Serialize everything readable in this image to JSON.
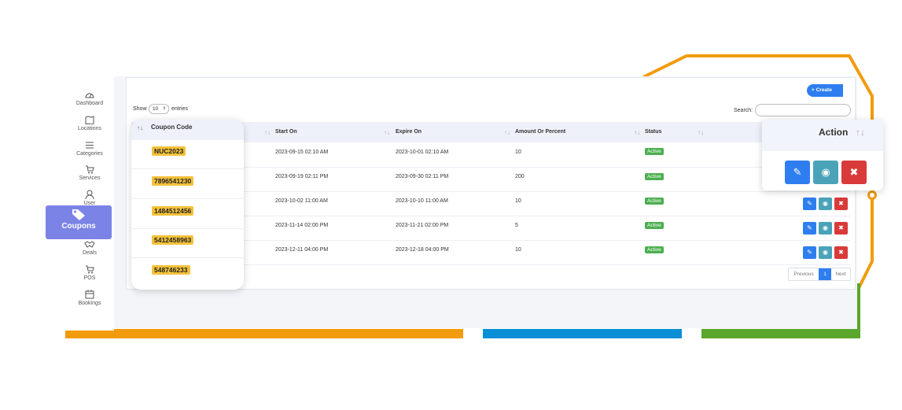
{
  "sidebar": {
    "items": [
      {
        "label": "Dashboard",
        "icon": "dashboard-icon"
      },
      {
        "label": "Locations",
        "icon": "location-icon"
      },
      {
        "label": "Categories",
        "icon": "list-icon"
      },
      {
        "label": "Services",
        "icon": "cart-icon"
      },
      {
        "label": "User",
        "icon": "user-icon"
      },
      {
        "label": "Deals",
        "icon": "handshake-icon"
      },
      {
        "label": "POS",
        "icon": "pos-cart-icon"
      },
      {
        "label": "Bookings",
        "icon": "calendar-icon"
      }
    ],
    "active": {
      "label": "Coupons",
      "icon": "tag-icon"
    }
  },
  "toolbar": {
    "create_label": "+ Create",
    "show_label": "Show",
    "entries_value": "10",
    "entries_label": "entries",
    "search_label": "Search:",
    "search_value": ""
  },
  "table": {
    "columns": [
      "Coupon Code",
      "Start On",
      "Expire On",
      "Amount Or Percent",
      "Status",
      "Action"
    ],
    "rows": [
      {
        "code": "NUC2023",
        "start": "2023-09-15 02:10 AM",
        "expire": "2023-10-01 02:10 AM",
        "amount": "10",
        "status": "Active"
      },
      {
        "code": "7896541230",
        "start": "2023-09-19 02:11 PM",
        "expire": "2023-09-30 02:11 PM",
        "amount": "200",
        "status": "Active"
      },
      {
        "code": "1484512456",
        "start": "2023-10-02 11:00 AM",
        "expire": "2023-10-10 11:00 AM",
        "amount": "10",
        "status": "Active"
      },
      {
        "code": "5412458963",
        "start": "2023-11-14 02:00 PM",
        "expire": "2023-11-21 02:00 PM",
        "amount": "5",
        "status": "Active"
      },
      {
        "code": "548746233",
        "start": "2023-12-11 04:00 PM",
        "expire": "2023-12-18 04:00 PM",
        "amount": "10",
        "status": "Active"
      }
    ]
  },
  "pagination": {
    "previous": "Previous",
    "current": "1",
    "next": "Next"
  },
  "icons": {
    "edit": "pencil-icon",
    "view": "eye-icon",
    "delete": "close-icon",
    "sort": "sort-icon"
  },
  "colors": {
    "accent": "#2f7ef0",
    "view": "#4aa3b8",
    "delete": "#d93a3a",
    "active": "#4caf50",
    "code_bg": "#f3c13a",
    "sidebar_active": "#7b83e6",
    "orange": "#f29b0d",
    "blue": "#0a8fd6",
    "green": "#5aa52c"
  }
}
